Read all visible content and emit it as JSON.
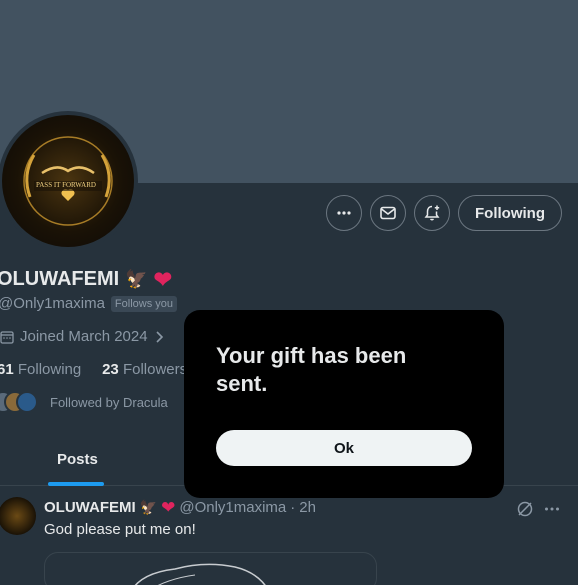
{
  "profile": {
    "display_name": "OLUWAFEMI",
    "handle": "@Only1maxima",
    "follows_you": "Follows you",
    "joined": "Joined March 2024",
    "following_count": "61",
    "following_label": "Following",
    "followers_count": "23",
    "followers_label": "Followers",
    "followed_by": "Followed by Dracula",
    "avatar_text": "PASS IT FORWARD",
    "emoji_eagle": "🦅",
    "emoji_heart": "❤"
  },
  "actions": {
    "following_button": "Following"
  },
  "tabs": {
    "posts": "Posts"
  },
  "post": {
    "author": "OLUWAFEMI",
    "handle": "@Only1maxima",
    "separator": "·",
    "time": "2h",
    "text": "God please put me on!"
  },
  "modal": {
    "title": "Your gift has been sent.",
    "ok_label": "Ok"
  },
  "colors": {
    "banner": "#425260",
    "background": "#26323c",
    "accent": "#1d9bf0",
    "heart": "#e0245e",
    "modal_bg": "#000000"
  }
}
